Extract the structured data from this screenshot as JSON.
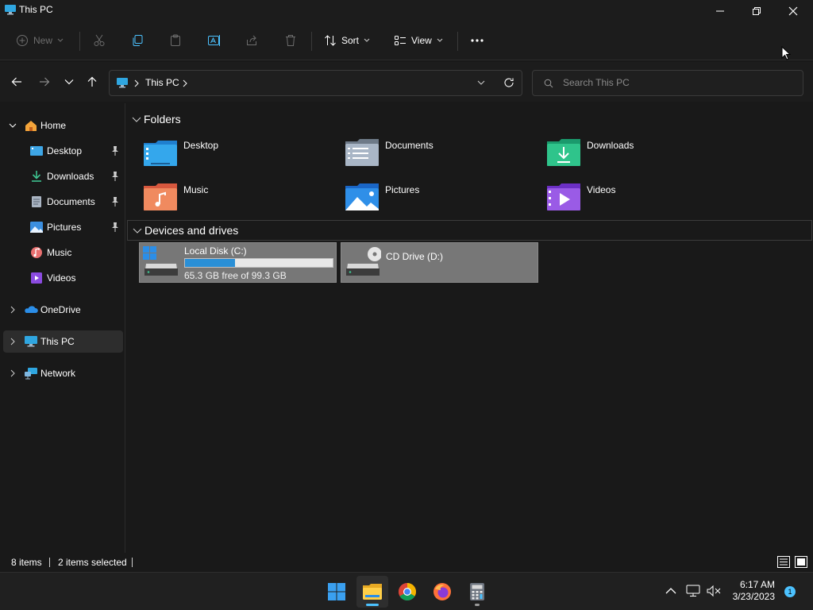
{
  "window": {
    "title": "This PC"
  },
  "toolbar": {
    "new_label": "New",
    "sort_label": "Sort",
    "view_label": "View"
  },
  "address": {
    "crumbs": [
      "This PC"
    ]
  },
  "search": {
    "placeholder": "Search This PC"
  },
  "sidebar": {
    "home": "Home",
    "quick_access": [
      {
        "label": "Desktop",
        "icon": "desktop-icon",
        "pinned": true
      },
      {
        "label": "Downloads",
        "icon": "downloads-icon",
        "pinned": true
      },
      {
        "label": "Documents",
        "icon": "documents-icon",
        "pinned": true
      },
      {
        "label": "Pictures",
        "icon": "pictures-icon",
        "pinned": true
      },
      {
        "label": "Music",
        "icon": "music-icon",
        "pinned": false
      },
      {
        "label": "Videos",
        "icon": "videos-icon",
        "pinned": false
      }
    ],
    "onedrive": "OneDrive",
    "this_pc": "This PC",
    "network": "Network"
  },
  "content": {
    "folders_header": "Folders",
    "folders": [
      {
        "label": "Desktop",
        "icon": "desktop-folder-icon"
      },
      {
        "label": "Documents",
        "icon": "documents-folder-icon"
      },
      {
        "label": "Downloads",
        "icon": "downloads-folder-icon"
      },
      {
        "label": "Music",
        "icon": "music-folder-icon"
      },
      {
        "label": "Pictures",
        "icon": "pictures-folder-icon"
      },
      {
        "label": "Videos",
        "icon": "videos-folder-icon"
      }
    ],
    "drives_header": "Devices and drives",
    "drives": [
      {
        "name": "Local Disk (C:)",
        "free": "65.3 GB free of 99.3 GB",
        "used_fraction": 0.34,
        "icon": "hard-drive-icon"
      },
      {
        "name": "CD Drive (D:)",
        "icon": "cd-drive-icon"
      }
    ]
  },
  "status": {
    "items": "8 items",
    "selected": "2 items selected"
  },
  "taskbar": {
    "time": "6:17 AM",
    "date": "3/23/2023",
    "notifications": "1"
  },
  "colors": {
    "accent": "#2a8fd6",
    "background": "#191919",
    "selection": "#777777"
  }
}
